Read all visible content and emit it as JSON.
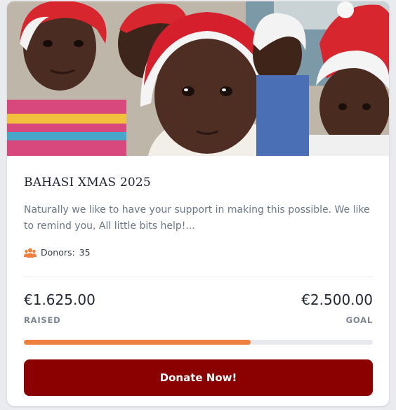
{
  "campaign": {
    "image_alt": "Children wearing red and white Santa hats",
    "title": "BAHASI XMAS 2025",
    "description": "Naturally we like to have your support in making this possible. We like to remind you, All little bits help!...",
    "donors_label": "Donors:",
    "donors_count": "35",
    "raised_amount": "€1.625.00",
    "raised_label": "RAISED",
    "goal_amount": "€2.500.00",
    "goal_label": "GOAL",
    "progress_fraction": 0.65,
    "donate_label": "Donate Now!"
  },
  "colors": {
    "accent": "#ef7f3e",
    "button": "#8b0000",
    "track": "#e7e9ee"
  },
  "icons": {
    "donors": "users-icon"
  }
}
